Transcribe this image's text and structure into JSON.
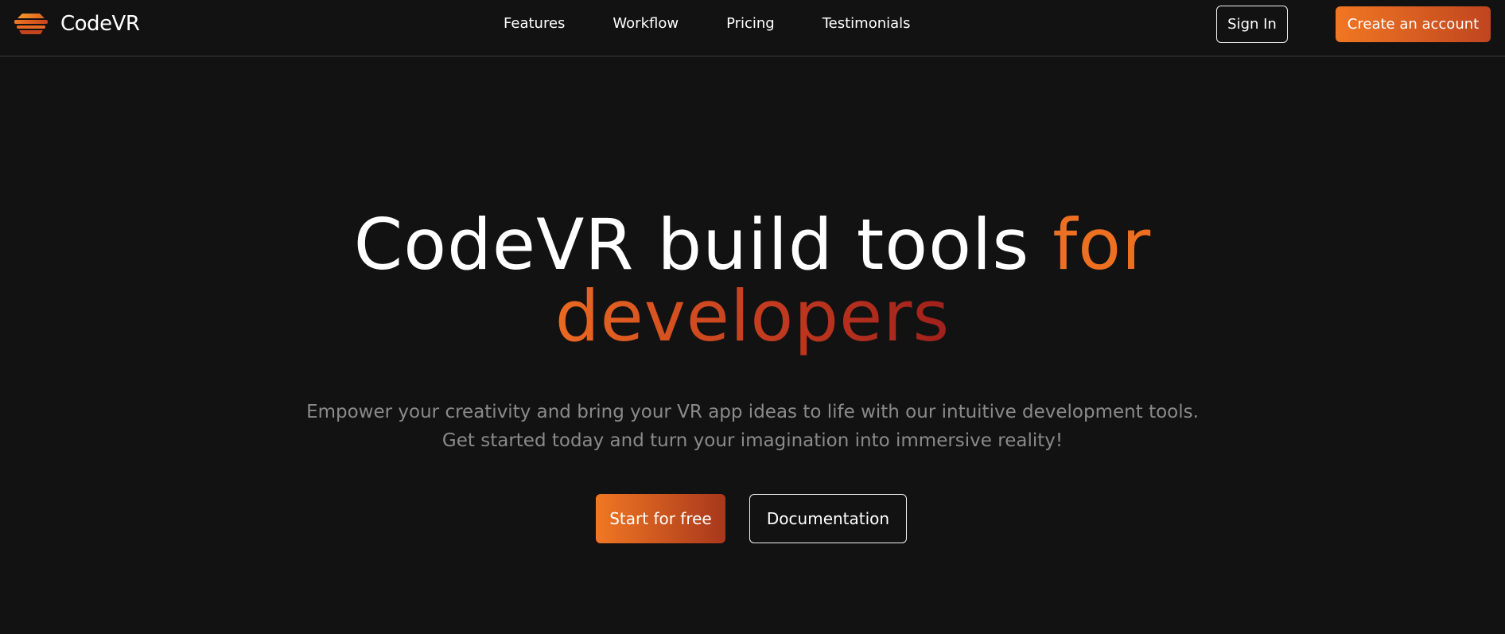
{
  "brand": {
    "name": "CodeVR",
    "icon": "layered-stack-icon",
    "accent_color": "#f07723",
    "accent_dark": "#a0201c"
  },
  "nav": {
    "links": [
      "Features",
      "Workflow",
      "Pricing",
      "Testimonials"
    ],
    "sign_in": "Sign In",
    "create_account": "Create an account"
  },
  "hero": {
    "title_white": "CodeVR build tools",
    "title_accent_line1": "for",
    "title_accent_line2": "developers",
    "subtitle_line1": "Empower your creativity and bring your VR app ideas to life with our intuitive development tools.",
    "subtitle_line2": "Get started today and turn your imagination into immersive reality!",
    "primary_cta": "Start for free",
    "secondary_cta": "Documentation"
  }
}
